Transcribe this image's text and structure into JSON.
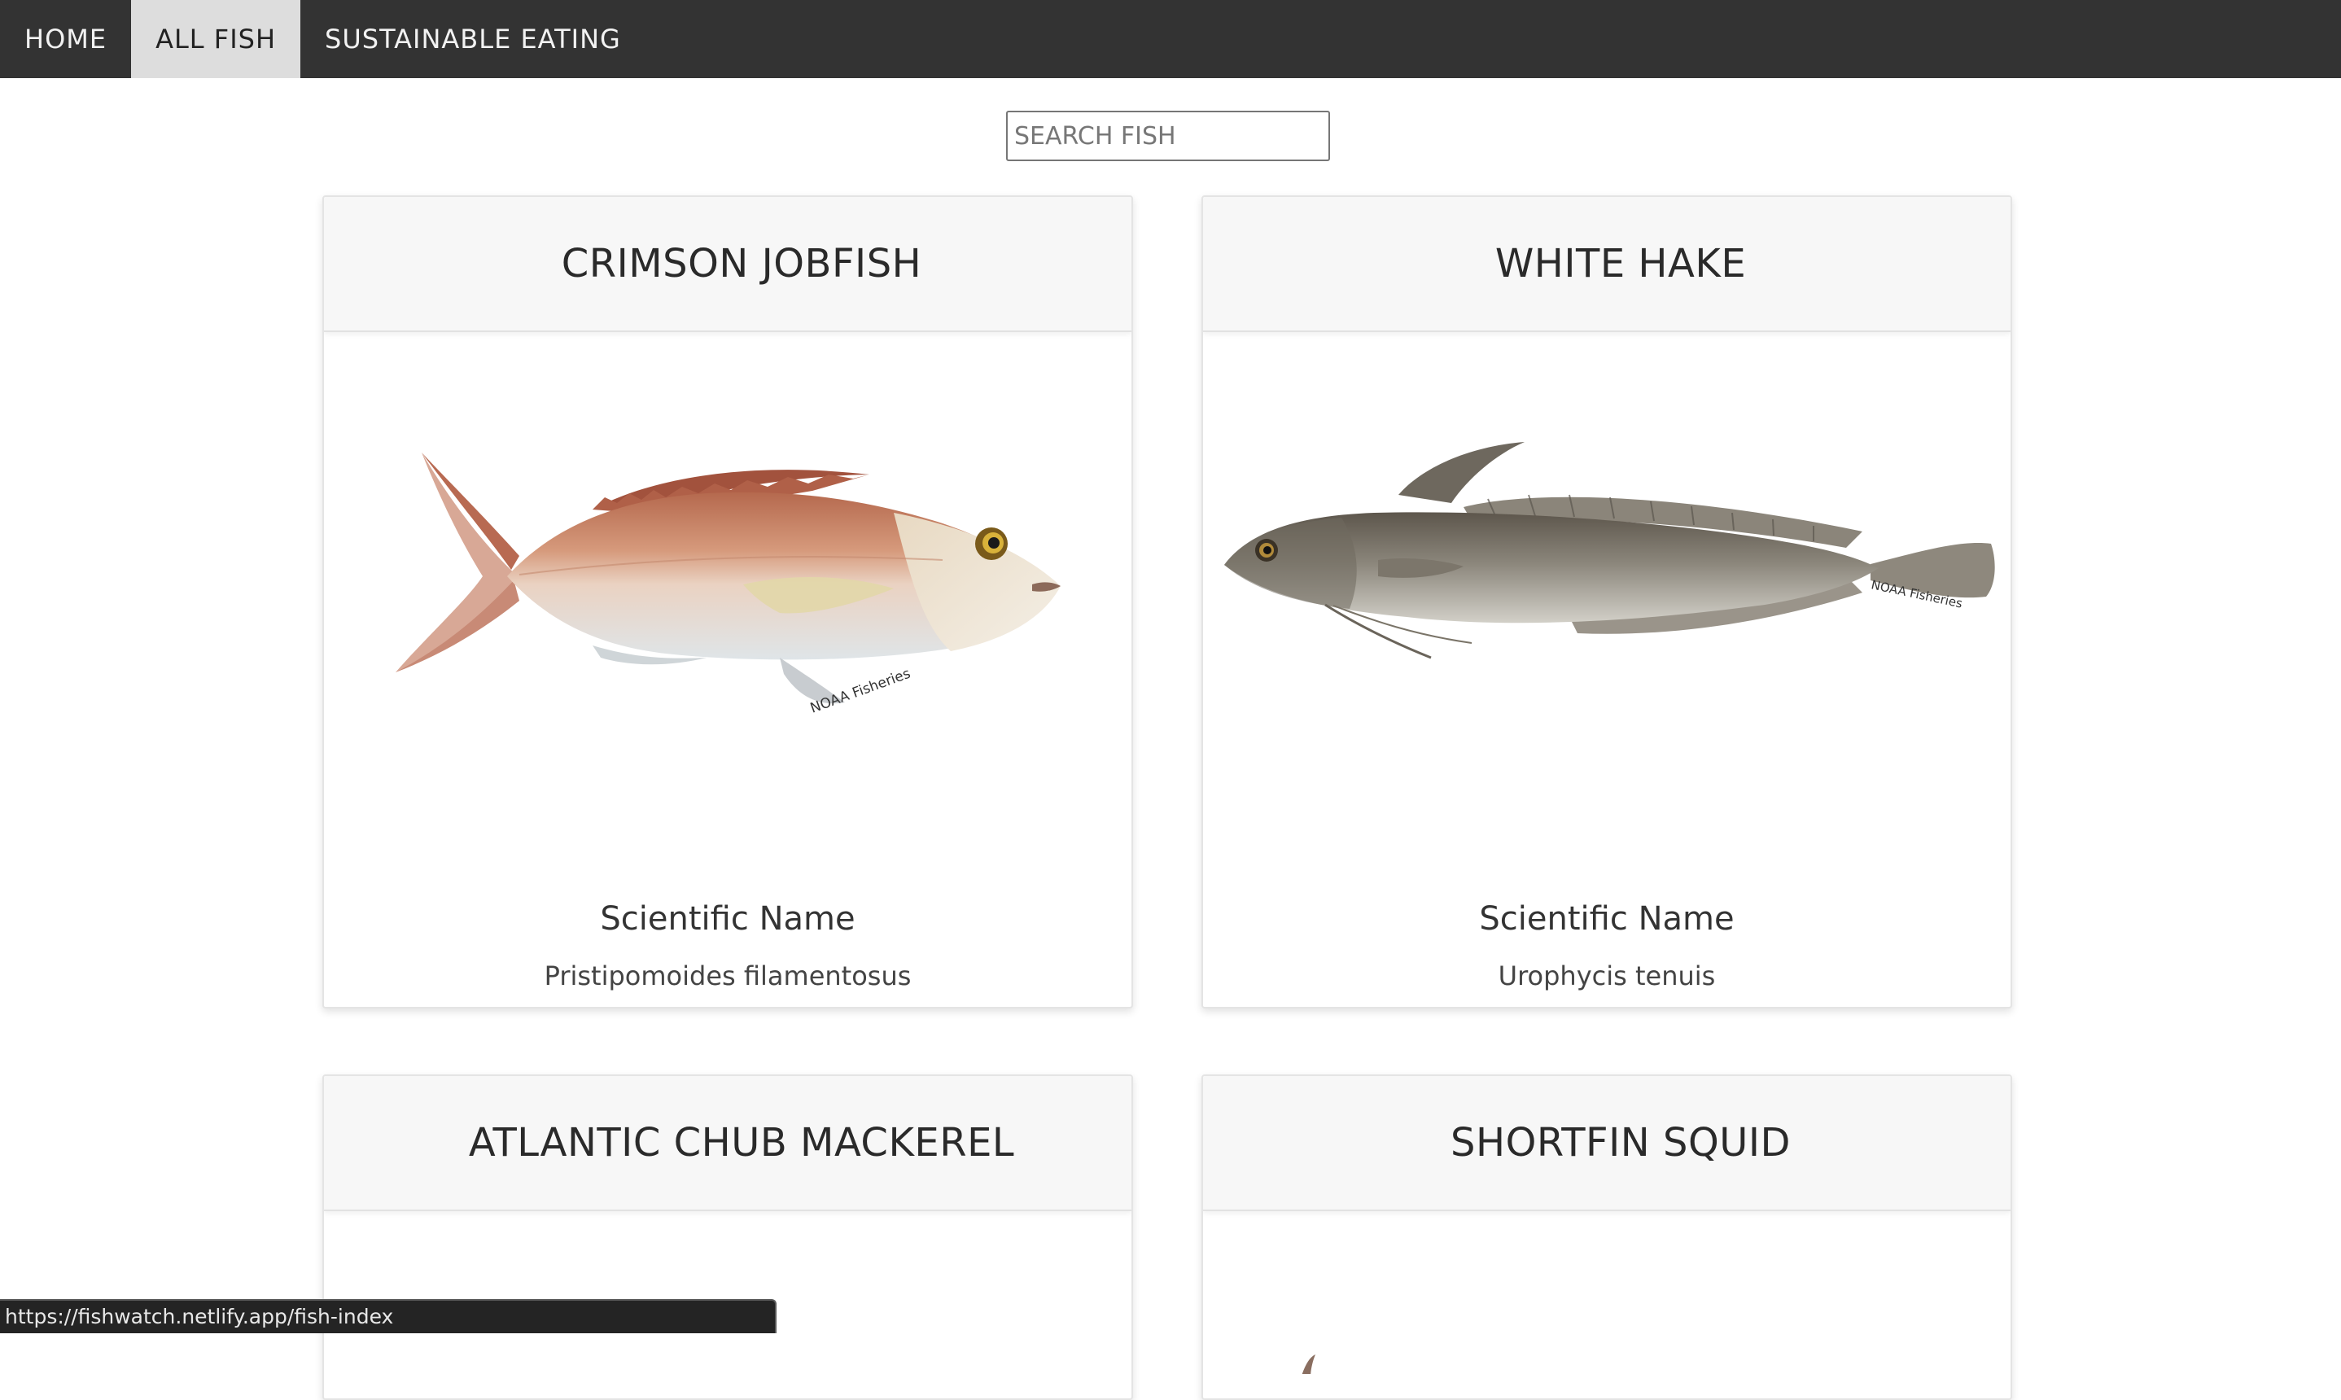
{
  "nav": {
    "items": [
      {
        "label": "HOME",
        "active": false
      },
      {
        "label": "ALL FISH",
        "active": true
      },
      {
        "label": "SUSTAINABLE EATING",
        "active": false
      }
    ]
  },
  "search": {
    "placeholder": "SEARCH FISH",
    "value": ""
  },
  "cards": [
    {
      "title": "CRIMSON JOBFISH",
      "image_icon": "crimson-jobfish-illustration",
      "sci_label": "Scientific Name",
      "sci_name": "Pristipomoides filamentosus",
      "watermark": "NOAA Fisheries"
    },
    {
      "title": "WHITE HAKE",
      "image_icon": "white-hake-illustration",
      "sci_label": "Scientific Name",
      "sci_name": "Urophycis tenuis",
      "watermark": "NOAA Fisheries"
    },
    {
      "title": "ATLANTIC CHUB MACKEREL"
    },
    {
      "title": "SHORTFIN SQUID"
    }
  ],
  "status": {
    "url": "https://fishwatch.netlify.app/fish-index"
  },
  "colors": {
    "nav_bg": "#333333",
    "nav_active_bg": "#dddddd",
    "card_head_bg": "#f7f7f7"
  }
}
